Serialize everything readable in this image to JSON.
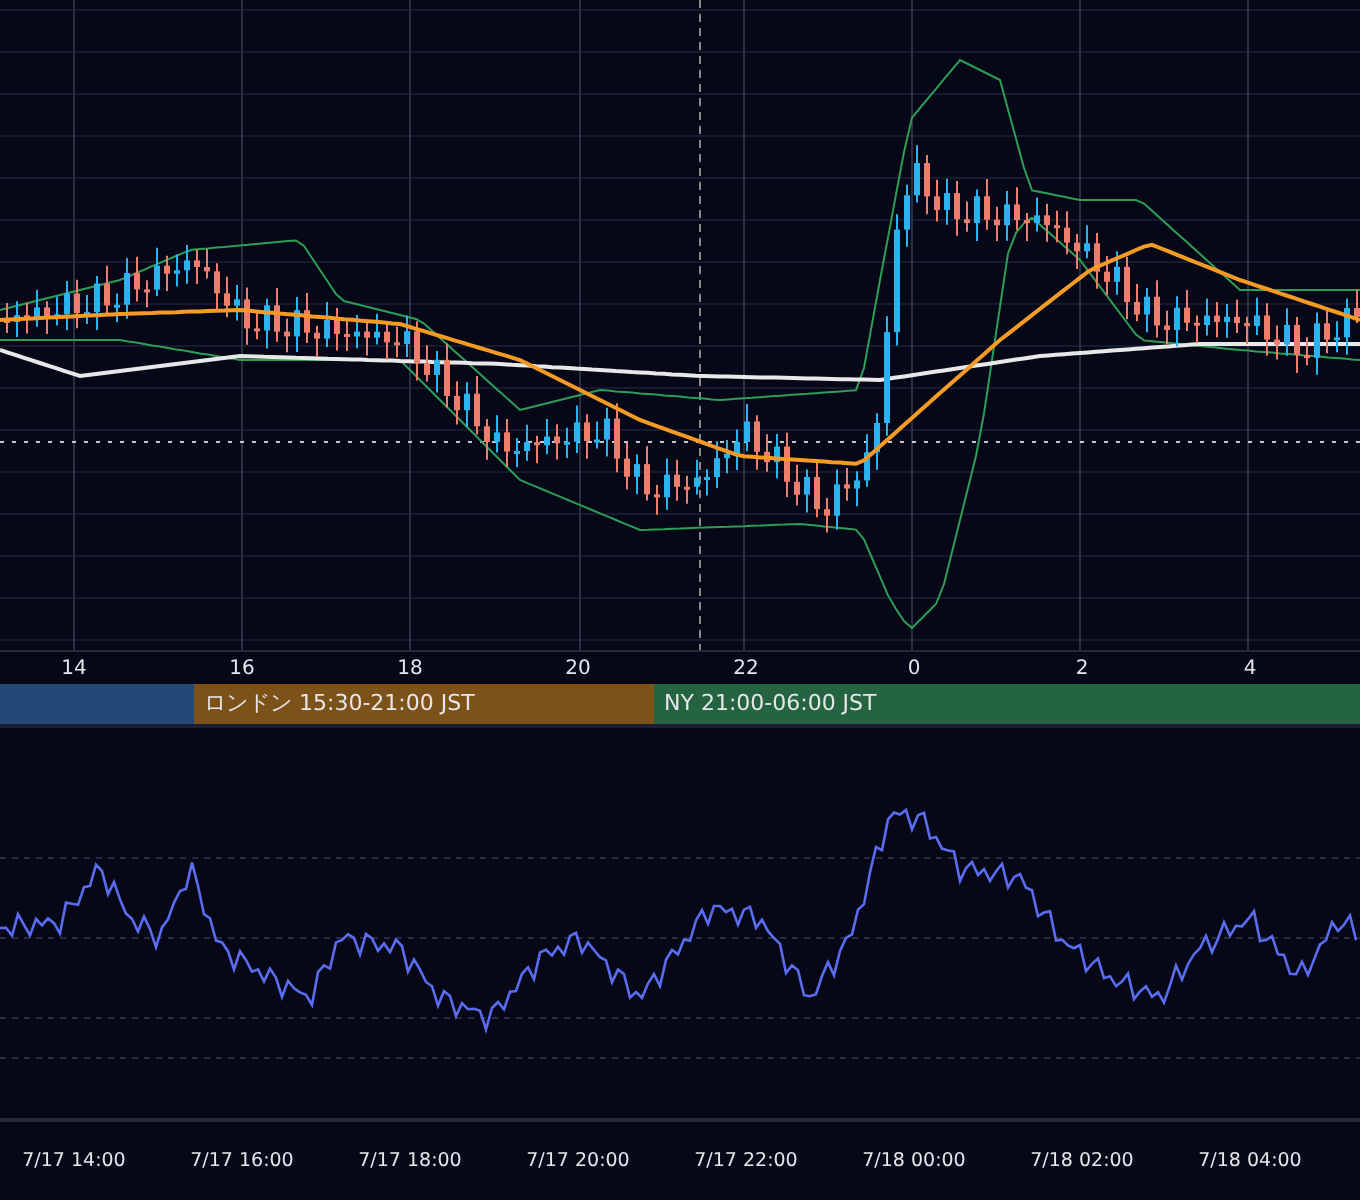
{
  "price_chart": {
    "x_axis_labels": [
      "14",
      "16",
      "18",
      "20",
      "22",
      "0",
      "2",
      "4"
    ]
  },
  "sessions": [
    {
      "color": "#234a77"
    },
    {
      "label": "ロンドン 15:30-21:00 JST",
      "color": "#7d5218"
    },
    {
      "label": "NY 21:00-06:00 JST",
      "color": "#256440"
    }
  ],
  "oscillator": {
    "x_axis_labels": [
      "7/17 14:00",
      "7/17 16:00",
      "7/17 18:00",
      "7/17 20:00",
      "7/17 22:00",
      "7/18 00:00",
      "7/18 02:00",
      "7/18 04:00"
    ]
  }
}
